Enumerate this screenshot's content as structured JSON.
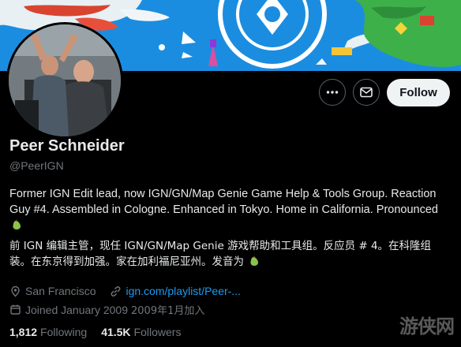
{
  "profile": {
    "name": "Peer Schneider",
    "handle": "@PeerIGN",
    "bio_en": "Former IGN Edit lead, now IGN/GN/Map Genie Game Help & Tools Group. Reaction Guy #4. Assembled in Cologne. Enhanced in Tokyo. Home in California. Pronounced",
    "bio_zh": "前 IGN 编辑主管，现任 IGN/GN/Map Genie 游戏帮助和工具组。反应员 # 4。在科隆组装。在东京得到加强。家在加利福尼亚州。发音为",
    "location": "San Francisco",
    "website": "ign.com/playlist/Peer-...",
    "joined": "Joined January 2009",
    "joined_zh": "2009年1月加入",
    "following_count": "1,812",
    "following_label": "Following",
    "followers_count": "41.5K",
    "followers_label": "Followers"
  },
  "actions": {
    "more_icon": "more-icon",
    "message_icon": "message-icon",
    "follow_label": "Follow"
  },
  "watermark": "游侠网",
  "colors": {
    "background": "#000000",
    "accent": "#1d9bf0",
    "muted": "#71767b",
    "banner": "#1d8fe0"
  }
}
